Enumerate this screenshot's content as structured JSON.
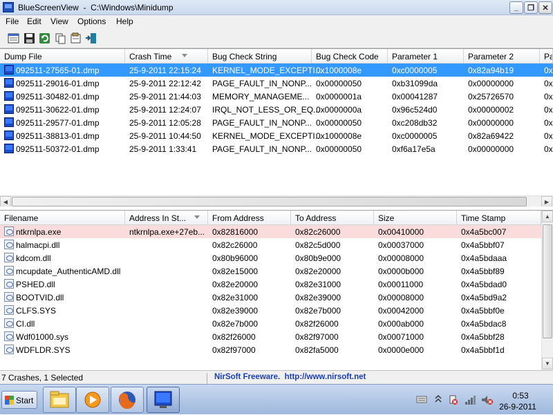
{
  "window": {
    "title": "BlueScreenView  -  C:\\Windows\\Minidump",
    "minimize_glyph": "_",
    "maximize_glyph": "❐",
    "close_glyph": "✕"
  },
  "menu": [
    "File",
    "Edit",
    "View",
    "Options",
    "Help"
  ],
  "toolbar_icons": [
    "properties-icon",
    "save-icon",
    "refresh-icon",
    "copy-icon",
    "properties-sheet-icon",
    "exit-icon"
  ],
  "top_table": {
    "columns": [
      "Dump File",
      "Crash Time",
      "Bug Check String",
      "Bug Check Code",
      "Parameter 1",
      "Parameter 2",
      "Pa"
    ],
    "sort_column": "Crash Time",
    "rows": [
      [
        "092511-27565-01.dmp",
        "25-9-2011 22:15:24",
        "KERNEL_MODE_EXCEPTI...",
        "0x1000008e",
        "0xc0000005",
        "0x82a94b19",
        "0x"
      ],
      [
        "092511-29016-01.dmp",
        "25-9-2011 22:12:42",
        "PAGE_FAULT_IN_NONP...",
        "0x00000050",
        "0xb31099da",
        "0x00000000",
        "0x"
      ],
      [
        "092511-30482-01.dmp",
        "25-9-2011 21:44:03",
        "MEMORY_MANAGEME...",
        "0x0000001a",
        "0x00041287",
        "0x25726570",
        "0x"
      ],
      [
        "092511-30622-01.dmp",
        "25-9-2011 12:24:07",
        "IRQL_NOT_LESS_OR_EQ...",
        "0x0000000a",
        "0x96c524d0",
        "0x00000002",
        "0x"
      ],
      [
        "092511-29577-01.dmp",
        "25-9-2011 12:05:28",
        "PAGE_FAULT_IN_NONP...",
        "0x00000050",
        "0xc208db32",
        "0x00000000",
        "0x"
      ],
      [
        "092511-38813-01.dmp",
        "25-9-2011 10:44:50",
        "KERNEL_MODE_EXCEPTI...",
        "0x1000008e",
        "0xc0000005",
        "0x82a69422",
        "0x"
      ],
      [
        "092511-50372-01.dmp",
        "25-9-2011 1:33:41",
        "PAGE_FAULT_IN_NONP...",
        "0x00000050",
        "0xf6a17e5a",
        "0x00000000",
        "0x"
      ]
    ]
  },
  "bottom_table": {
    "columns": [
      "Filename",
      "Address In St...",
      "From Address",
      "To Address",
      "Size",
      "Time Stamp"
    ],
    "sort_column": "Address In St...",
    "rows": [
      [
        "ntkrnlpa.exe",
        "ntkrnlpa.exe+27eb...",
        "0x82816000",
        "0x82c26000",
        "0x00410000",
        "0x4a5bc007"
      ],
      [
        "halmacpi.dll",
        "",
        "0x82c26000",
        "0x82c5d000",
        "0x00037000",
        "0x4a5bbf07"
      ],
      [
        "kdcom.dll",
        "",
        "0x80b96000",
        "0x80b9e000",
        "0x00008000",
        "0x4a5bdaaa"
      ],
      [
        "mcupdate_AuthenticAMD.dll",
        "",
        "0x82e15000",
        "0x82e20000",
        "0x0000b000",
        "0x4a5bbf89"
      ],
      [
        "PSHED.dll",
        "",
        "0x82e20000",
        "0x82e31000",
        "0x00011000",
        "0x4a5bdad0"
      ],
      [
        "BOOTVID.dll",
        "",
        "0x82e31000",
        "0x82e39000",
        "0x00008000",
        "0x4a5bd9a2"
      ],
      [
        "CLFS.SYS",
        "",
        "0x82e39000",
        "0x82e7b000",
        "0x00042000",
        "0x4a5bbf0e"
      ],
      [
        "CI.dll",
        "",
        "0x82e7b000",
        "0x82f26000",
        "0x000ab000",
        "0x4a5bdac8"
      ],
      [
        "Wdf01000.sys",
        "",
        "0x82f26000",
        "0x82f97000",
        "0x00071000",
        "0x4a5bbf28"
      ],
      [
        "WDFLDR.SYS",
        "",
        "0x82f97000",
        "0x82fa5000",
        "0x0000e000",
        "0x4a5bbf1d"
      ]
    ]
  },
  "status": {
    "summary": "7 Crashes, 1 Selected",
    "link": "NirSoft Freeware.  http://www.nirsoft.net"
  },
  "taskbar": {
    "start_label": "Start",
    "apps": [
      "explorer-icon",
      "media-player-icon",
      "firefox-icon",
      "bluescreenview-icon"
    ],
    "clock_time": "0:53",
    "clock_date": "26-9-2011"
  },
  "colors": {
    "selection": "#3399ff",
    "highlight_row": "#fbdcdc",
    "link": "#1a3fb8"
  }
}
